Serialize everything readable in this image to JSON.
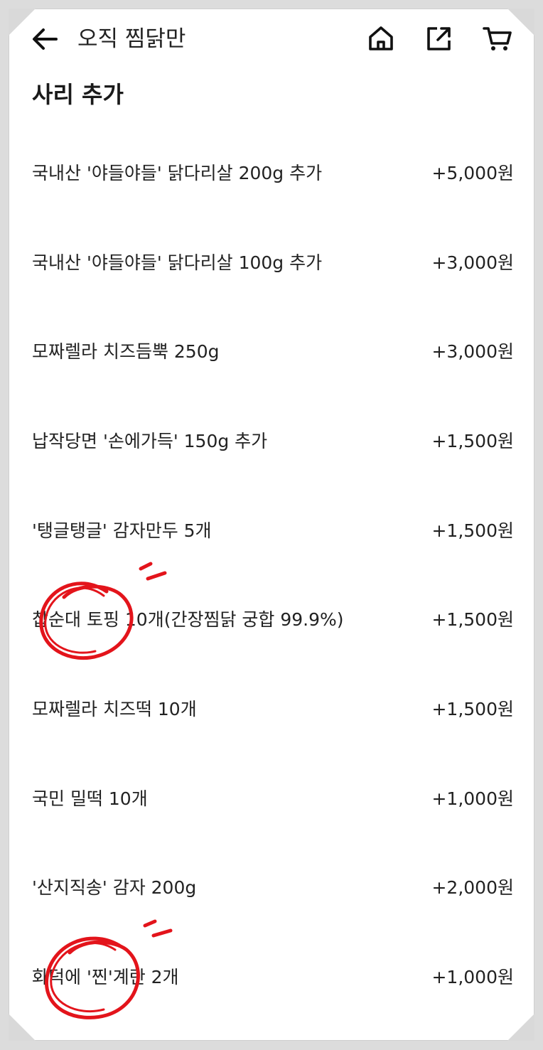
{
  "header": {
    "title": "오직 찜닭만",
    "icons": [
      "back-arrow-icon",
      "home-icon",
      "share-icon",
      "cart-icon"
    ]
  },
  "section": {
    "title": "사리 추가"
  },
  "options": [
    {
      "name": "국내산 '야들야들' 닭다리살 200g 추가",
      "price": "+5,000원"
    },
    {
      "name": "국내산 '야들야들' 닭다리살 100g 추가",
      "price": "+3,000원"
    },
    {
      "name": "모짜렐라 치즈듬뿍 250g",
      "price": "+3,000원"
    },
    {
      "name": "납작당면 '손에가득' 150g 추가",
      "price": "+1,500원"
    },
    {
      "name": "'탱글탱글' 감자만두 5개",
      "price": "+1,500원"
    },
    {
      "name": "찹순대 토핑 10개(간장찜닭 궁합 99.9%)",
      "price": "+1,500원"
    },
    {
      "name": "모짜렐라 치즈떡 10개",
      "price": "+1,500원"
    },
    {
      "name": "국민 밀떡 10개",
      "price": "+1,000원"
    },
    {
      "name": "'산지직송' 감자  200g",
      "price": "+2,000원"
    },
    {
      "name": "화덕에 '찐'계란 2개",
      "price": "+1,000원"
    }
  ],
  "colors": {
    "annotation": "#e3141b",
    "text": "#222222",
    "background": "#ffffff"
  }
}
